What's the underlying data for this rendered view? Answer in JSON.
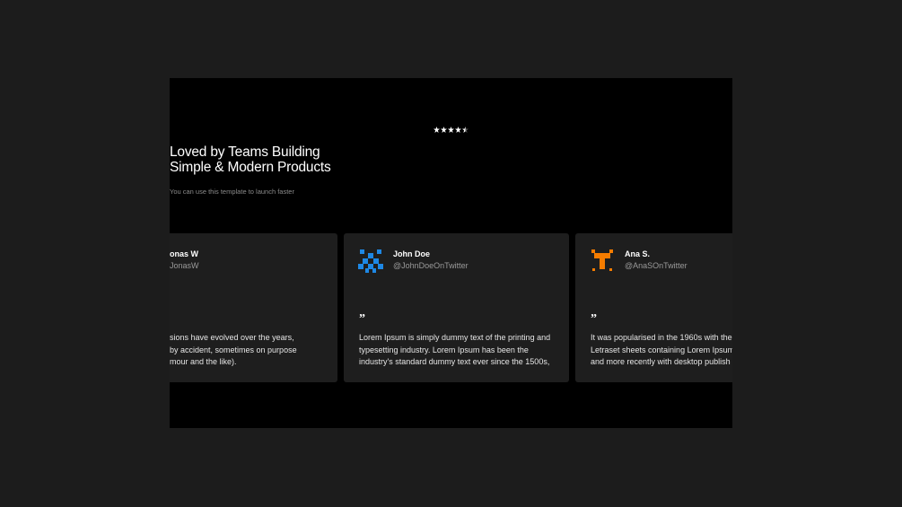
{
  "hero": {
    "rating_stars": 4.5,
    "title_line1": "Loved by Teams Building",
    "title_line2": "Simple & Modern Products",
    "subtitle": "You can use this template to launch faster"
  },
  "testimonials": [
    {
      "name": "onas W",
      "handle": "JonasW",
      "quote_mark": "”",
      "lines": [
        "sions have evolved over the years,",
        " by accident, sometimes on purpose",
        "mour and the like)."
      ]
    },
    {
      "name": "John Doe",
      "handle": "@JohnDoeOnTwitter",
      "quote_mark": "”",
      "avatar_color": "#1e88e5",
      "lines": [
        "Lorem Ipsum is simply dummy text of the printing and",
        "typesetting industry. Lorem Ipsum has been the",
        "industry's standard dummy text ever since the 1500s,"
      ]
    },
    {
      "name": "Ana S.",
      "handle": "@AnaSOnTwitter",
      "quote_mark": "”",
      "avatar_color": "#f57c00",
      "lines": [
        "It was popularised in the 1960s with the",
        "Letraset sheets containing Lorem Ipsum",
        "and more recently with desktop publish"
      ]
    }
  ],
  "colors": {
    "page_background": "#1c1c1c",
    "frame_background": "#000000",
    "card_background": "#1e1e1e"
  }
}
